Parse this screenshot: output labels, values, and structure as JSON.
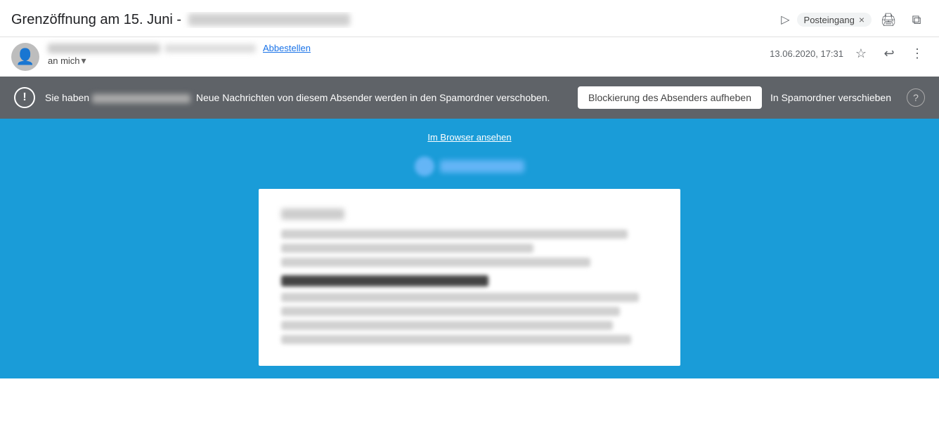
{
  "email": {
    "subject_prefix": "Grenzöffnung am 15. Juni -",
    "inbox_tag": "Posteingang",
    "inbox_tag_close": "×",
    "date": "13.06.2020, 17:31",
    "recipient_label": "an mich",
    "unsubscribe_label": "Abbestellen",
    "view_in_browser": "Im Browser ansehen",
    "spam_banner": {
      "text_suffix": "Neue Nachrichten von diesem Absender werden in den Spamordner verschoben.",
      "unblock_btn": "Blockierung des Absenders aufheben",
      "spam_folder_btn": "In Spamordner verschieben"
    },
    "icons": {
      "print": "🖨",
      "open_new": "⧉",
      "star": "☆",
      "reply": "↩",
      "more": "⋮",
      "warning": "!",
      "help": "?"
    }
  }
}
